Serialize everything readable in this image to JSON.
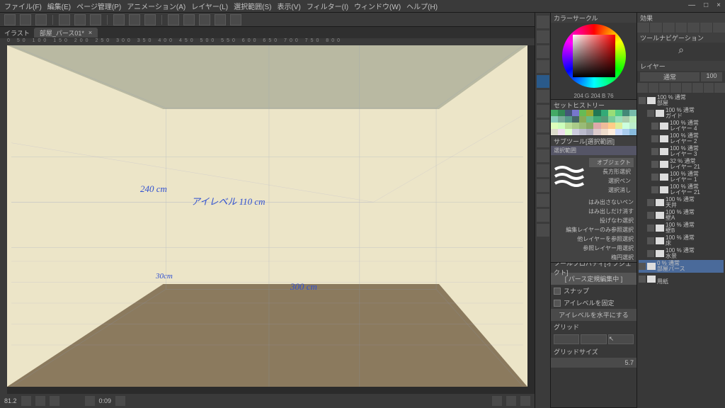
{
  "menu": {
    "items": [
      "ファイル(F)",
      "編集(E)",
      "ページ管理(P)",
      "アニメーション(A)",
      "レイヤー(L)",
      "選択範囲(S)",
      "表示(V)",
      "フィルター(I)",
      "ウィンドウ(W)",
      "ヘルプ(H)"
    ]
  },
  "window_controls": {
    "min": "—",
    "max": "□",
    "close": "×"
  },
  "tab": {
    "label": "部屋_パース01*",
    "close": "×",
    "doc": "イラスト"
  },
  "ruler_marks": "0 50 100 150 200 250 300 350 400 450 500 550 600 650 700 750 800",
  "canvas": {
    "annotations": {
      "height": "240 cm",
      "eye": "アイレベル 110 cm",
      "depth_small": "30cm",
      "depth": "300 cm"
    }
  },
  "status": {
    "zoom": "81.2",
    "time": "0:09"
  },
  "color": {
    "title": "カラーサークル",
    "read": "204  G 204  B 76"
  },
  "sethistory": {
    "title": "セットヒストリー"
  },
  "swatch_colors": [
    "#4a6",
    "#385",
    "#457",
    "#77c",
    "#6b5",
    "#9a3",
    "#275",
    "#3a7",
    "#9d7",
    "#5c8",
    "#487",
    "#7ba",
    "#8cb",
    "#7a9",
    "#598",
    "#466",
    "#8a5",
    "#6b8",
    "#4a7",
    "#597",
    "#7c9",
    "#9db",
    "#aca",
    "#beb",
    "#dfb",
    "#cfb",
    "#bd9",
    "#ac8",
    "#9b7",
    "#8a6",
    "#daa",
    "#eb9",
    "#fc8",
    "#de9",
    "#cfd",
    "#bec",
    "#ddc",
    "#ede",
    "#dfc",
    "#ccd",
    "#bbc",
    "#aab",
    "#dcc",
    "#edc",
    "#fed",
    "#cdf",
    "#ace",
    "#8bd"
  ],
  "subtool": {
    "title": "サブツール[選択範囲]",
    "header": "選択範囲",
    "object": "オブジェクト",
    "items": [
      "長方形選択",
      "選択ペン",
      "選択消し",
      "はみ出さないペン",
      "はみ出しだけ消す",
      "投げなわ選択",
      "編集レイヤーのみ参照選択",
      "他レイヤーを参照選択",
      "参照レイヤー用選択",
      "楕円選択"
    ]
  },
  "props": {
    "title": "ツールプロパティ[オブジェクト]",
    "editing": "[ パース定規編集中 ]",
    "snap": "スナップ",
    "fix": "アイレベルを固定",
    "level": "アイレベルを水平にする",
    "grid": "グリッド",
    "gridsize": "グリッドサイズ",
    "gridval": "5.7"
  },
  "nav": {
    "title": "ツールナビゲーション",
    "effect": "効果"
  },
  "layers": {
    "title": "レイヤー",
    "mode": "通常",
    "opacity": "100",
    "items": [
      {
        "lbl": "100 % 通常",
        "sub": "部屋",
        "ch": 1
      },
      {
        "lbl": "100 % 通常",
        "sub": "ガイド",
        "ch": 2
      },
      {
        "lbl": "100 % 通常",
        "sub": "レイヤー 4",
        "ch": 3
      },
      {
        "lbl": "100 % 通常",
        "sub": "レイヤー 2",
        "ch": 3
      },
      {
        "lbl": "100 % 通常",
        "sub": "レイヤー 3",
        "ch": 3
      },
      {
        "lbl": "32 % 通常",
        "sub": "レイヤー 21",
        "ch": 3
      },
      {
        "lbl": "100 % 通常",
        "sub": "レイヤー 1",
        "ch": 3
      },
      {
        "lbl": "100 % 通常",
        "sub": "レイヤー 21",
        "ch": 3
      },
      {
        "lbl": "100 % 通常",
        "sub": "天井",
        "ch": 2
      },
      {
        "lbl": "100 % 通常",
        "sub": "壁A",
        "ch": 2
      },
      {
        "lbl": "100 % 通常",
        "sub": "壁B",
        "ch": 2
      },
      {
        "lbl": "100 % 通常",
        "sub": "床",
        "ch": 2
      },
      {
        "lbl": "100 % 通常",
        "sub": "水景",
        "ch": 2
      },
      {
        "lbl": "0 % 通常",
        "sub": "部屋パース",
        "ch": 1,
        "sel": true
      },
      {
        "lbl": "",
        "sub": "用紙",
        "ch": 1
      }
    ]
  }
}
